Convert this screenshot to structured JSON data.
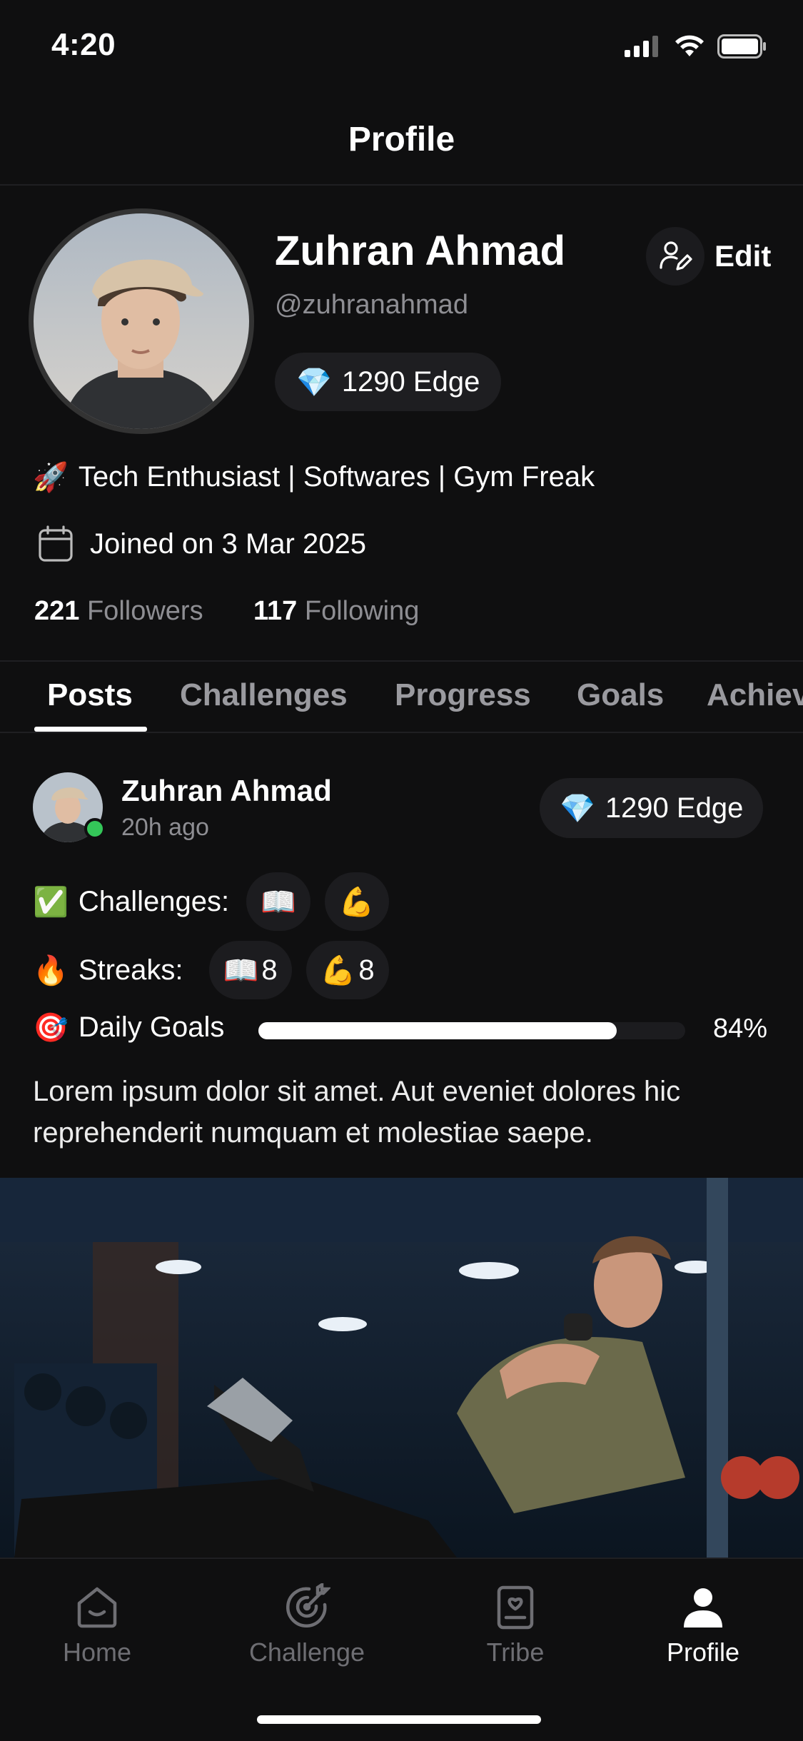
{
  "status": {
    "time": "4:20"
  },
  "header": {
    "title": "Profile"
  },
  "profile": {
    "name": "Zuhran Ahmad",
    "handle": "@zuhranahmad",
    "edge_icon": "💎",
    "edge": "1290 Edge",
    "edit_label": "Edit",
    "bio_icon": "🚀",
    "bio": "Tech Enthusiast | Softwares | Gym Freak",
    "joined": "Joined on 3 Mar 2025",
    "followers_count": "221",
    "followers_label": "Followers",
    "following_count": "117",
    "following_label": "Following"
  },
  "tabs": [
    {
      "label": "Posts",
      "active": true
    },
    {
      "label": "Challenges"
    },
    {
      "label": "Progress"
    },
    {
      "label": "Goals"
    },
    {
      "label": "Achievements"
    }
  ],
  "post": {
    "author": "Zuhran Ahmad",
    "time": "20h ago",
    "edge_icon": "💎",
    "edge": "1290 Edge",
    "challenges_icon": "✅",
    "challenges_label": "Challenges:",
    "challenge_chips": [
      "📖",
      "💪"
    ],
    "streaks_icon": "🔥",
    "streaks_label": "Streaks:",
    "streak_chips": [
      {
        "icon": "📖",
        "count": "8"
      },
      {
        "icon": "💪",
        "count": "8"
      }
    ],
    "goals_icon": "🎯",
    "goals_label": "Daily Goals",
    "goals_progress": 0.84,
    "goals_pct": "84%",
    "text": "Lorem ipsum dolor sit amet. Aut eveniet dolores hic reprehenderit numquam et molestiae saepe."
  },
  "bottom_nav": [
    {
      "label": "Home",
      "icon": "home-icon"
    },
    {
      "label": "Challenge",
      "icon": "challenge-icon"
    },
    {
      "label": "Tribe",
      "icon": "tribe-icon"
    },
    {
      "label": "Profile",
      "icon": "profile-icon",
      "active": true
    }
  ]
}
